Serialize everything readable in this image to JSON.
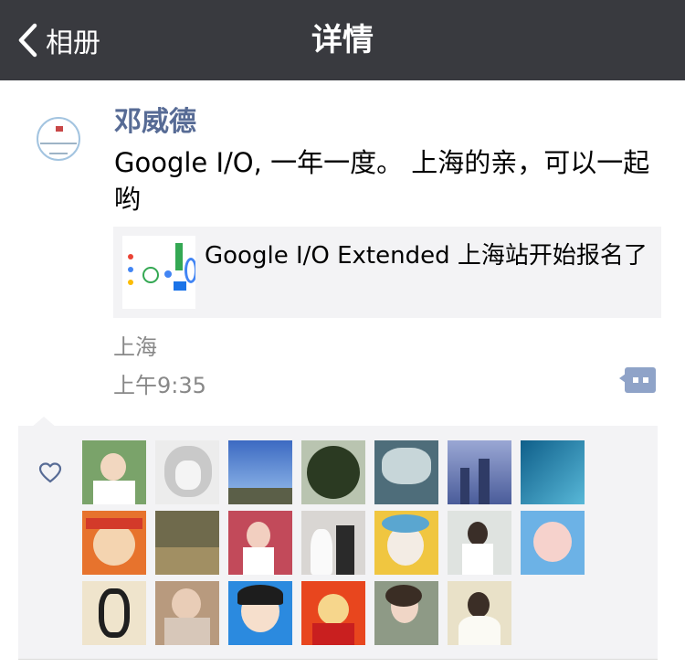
{
  "navbar": {
    "back_label": "相册",
    "title": "详情"
  },
  "post": {
    "author": "邓威德",
    "text": "Google I/O, 一年一度。 上海的亲，可以一起哟",
    "link": {
      "title": "Google I/O Extended 上海站开始报名了"
    },
    "location": "上海",
    "time": "上午9:35"
  },
  "likes": {
    "icon": "heart-outline-icon",
    "avatars": [
      "liker-1",
      "liker-2",
      "liker-3",
      "liker-4",
      "liker-5",
      "liker-6",
      "liker-7",
      "liker-8",
      "liker-9",
      "liker-10",
      "liker-11",
      "liker-12",
      "liker-13",
      "liker-14",
      "liker-15",
      "liker-16",
      "liker-17",
      "liker-18",
      "liker-19",
      "liker-20"
    ]
  },
  "colors": {
    "navbar_bg": "#393a3f",
    "author_name": "#576b95",
    "panel_bg": "#f3f3f5",
    "comment_button": "#8fa3c8"
  }
}
